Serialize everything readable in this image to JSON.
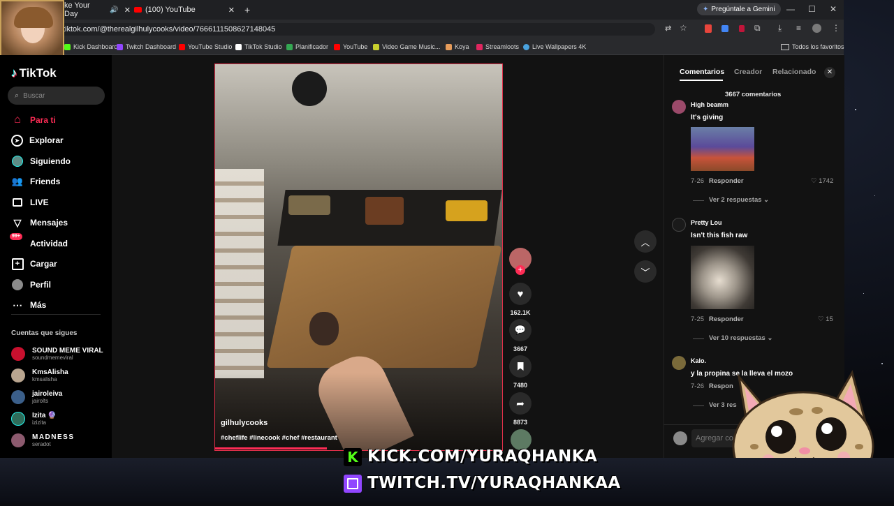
{
  "browser": {
    "tabs": [
      {
        "label": "ke Your Day",
        "active": false
      },
      {
        "label": "(100) YouTube",
        "active": false
      }
    ],
    "new_tab": "+",
    "gemini_button": "Pregúntale a Gemini",
    "url": "tiktok.com/@therealgilhulycooks/video/7666111508627148045",
    "bookmarks": [
      {
        "label": "Kick Dashboard",
        "color": "#53fc18"
      },
      {
        "label": "Twitch Dashboard",
        "color": "#9146ff"
      },
      {
        "label": "YouTube Studio",
        "color": "#ff0000"
      },
      {
        "label": "TikTok Studio",
        "color": "#ffffff"
      },
      {
        "label": "Planificador",
        "color": "#34a853"
      },
      {
        "label": "YouTube",
        "color": "#ff0000"
      },
      {
        "label": "Video Game Music...",
        "color": "#c8d02e"
      },
      {
        "label": "Koya",
        "color": "#e59b5a"
      },
      {
        "label": "Streamloots",
        "color": "#e0265f"
      },
      {
        "label": "Live Wallpapers 4K",
        "color": "#4aa3df"
      }
    ],
    "all_favorites": "Todos los favoritos"
  },
  "tiktok": {
    "logo": "TikTok",
    "search_placeholder": "Buscar",
    "nav": [
      {
        "label": "Para ti",
        "icon": "home-icon",
        "active": true
      },
      {
        "label": "Explorar",
        "icon": "compass-icon"
      },
      {
        "label": "Siguiendo",
        "icon": "following-avatar-icon"
      },
      {
        "label": "Friends",
        "icon": "friends-icon"
      },
      {
        "label": "LIVE",
        "icon": "live-icon"
      },
      {
        "label": "Mensajes",
        "icon": "send-icon"
      },
      {
        "label": "Actividad",
        "icon": "activity-icon",
        "badge": "99+"
      },
      {
        "label": "Cargar",
        "icon": "upload-icon"
      },
      {
        "label": "Perfil",
        "icon": "profile-icon"
      },
      {
        "label": "Más",
        "icon": "more-icon"
      }
    ],
    "following_title": "Cuentas que sigues",
    "following": [
      {
        "name": "SOUND MEME VIRAL",
        "handle": "soundmemeviral",
        "color": "#c8102e"
      },
      {
        "name": "KmsAlisha",
        "handle": "kmsalisha",
        "color": "#b9a58f"
      },
      {
        "name": "jairoleiva",
        "handle": "jairolts",
        "color": "#3b5f8a"
      },
      {
        "name": "Izita 🔮",
        "handle": "izizita",
        "color": "#2f6c5a"
      },
      {
        "name": "MADNESS",
        "handle": "seradot",
        "color": "#8c5a6e"
      }
    ],
    "video": {
      "author": "gilhulycooks",
      "caption": "#cheflife #linecook #chef #restaurant"
    },
    "actions": [
      {
        "icon": "heart-icon",
        "count": "162.1K"
      },
      {
        "icon": "comment-icon",
        "count": "3667"
      },
      {
        "icon": "bookmark-icon",
        "count": "7480"
      },
      {
        "icon": "share-icon",
        "count": "8873"
      }
    ],
    "panel": {
      "tabs": [
        "Comentarios",
        "Creador",
        "Relacionado"
      ],
      "count_label": "3667 comentarios",
      "comments": [
        {
          "user": "High beamm",
          "text": "It's giving",
          "date": "7-26",
          "reply": "Responder",
          "likes": "1742",
          "replies": "Ver 2 respuestas"
        },
        {
          "user": "Pretty Lou",
          "text": "Isn't this fish raw",
          "date": "7-25",
          "reply": "Responder",
          "likes": "15",
          "replies": "Ver 10 respuestas"
        },
        {
          "user": "Kalo.",
          "text": "y la propina se la lleva el mozo",
          "date": "7-26",
          "reply": "Respon",
          "likes": "",
          "replies": "Ver 3 res"
        }
      ],
      "add_comment_placeholder": "Agregar co"
    }
  },
  "overlay": {
    "kick": "KICK.COM/YURAQHANKA",
    "twitch": "TWITCH.TV/YURAQHANKAA"
  }
}
